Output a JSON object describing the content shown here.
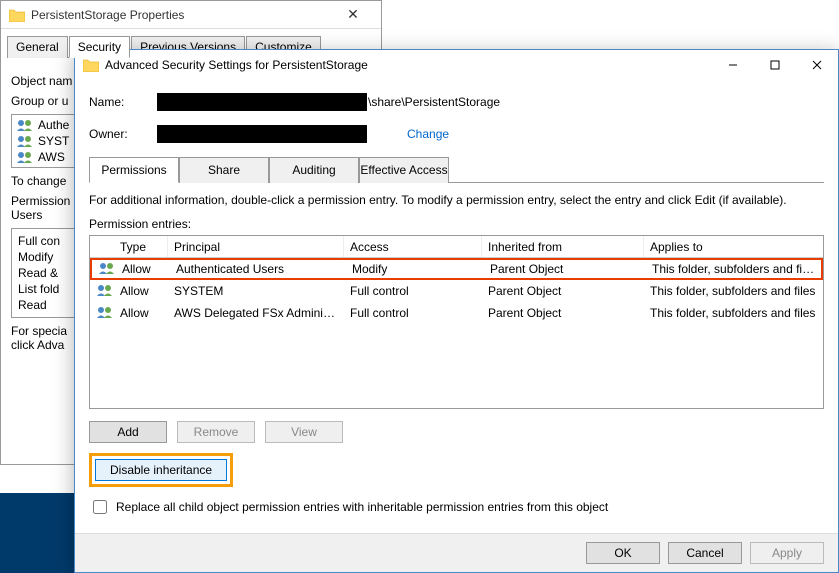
{
  "back_window": {
    "title": "PersistentStorage Properties",
    "tabs": [
      "General",
      "Security",
      "Previous Versions",
      "Customize"
    ],
    "active_tab": 1,
    "object_label": "Object nam",
    "group_label": "Group or u",
    "users": [
      "Authe",
      "SYST",
      "AWS"
    ],
    "change_hint": "To change",
    "perm_label": "Permission",
    "perm_label2": "Users",
    "perm_rows": [
      "Full con",
      "Modify",
      "Read &",
      "List fold",
      "Read"
    ],
    "special_hint": "For specia",
    "special_hint2": "click Adva"
  },
  "adv_window": {
    "title": "Advanced Security Settings for PersistentStorage",
    "name_label": "Name:",
    "name_path": "\\share\\PersistentStorage",
    "owner_label": "Owner:",
    "change_link": "Change",
    "tabs": [
      "Permissions",
      "Share",
      "Auditing",
      "Effective Access"
    ],
    "active_tab": 0,
    "instructions": "For additional information, double-click a permission entry. To modify a permission entry, select the entry and click Edit (if available).",
    "entries_label": "Permission entries:",
    "columns": {
      "type": "Type",
      "principal": "Principal",
      "access": "Access",
      "inherited": "Inherited from",
      "applies": "Applies to"
    },
    "rows": [
      {
        "type": "Allow",
        "principal": "Authenticated Users",
        "access": "Modify",
        "inherited": "Parent Object",
        "applies": "This folder, subfolders and files",
        "highlight": true
      },
      {
        "type": "Allow",
        "principal": "SYSTEM",
        "access": "Full control",
        "inherited": "Parent Object",
        "applies": "This folder, subfolders and files",
        "highlight": false
      },
      {
        "type": "Allow",
        "principal": "AWS Delegated FSx Administr...",
        "access": "Full control",
        "inherited": "Parent Object",
        "applies": "This folder, subfolders and files",
        "highlight": false
      }
    ],
    "buttons": {
      "add": "Add",
      "remove": "Remove",
      "view": "View",
      "disable": "Disable inheritance"
    },
    "replace_checkbox": "Replace all child object permission entries with inheritable permission entries from this object",
    "footer": {
      "ok": "OK",
      "cancel": "Cancel",
      "apply": "Apply"
    }
  }
}
